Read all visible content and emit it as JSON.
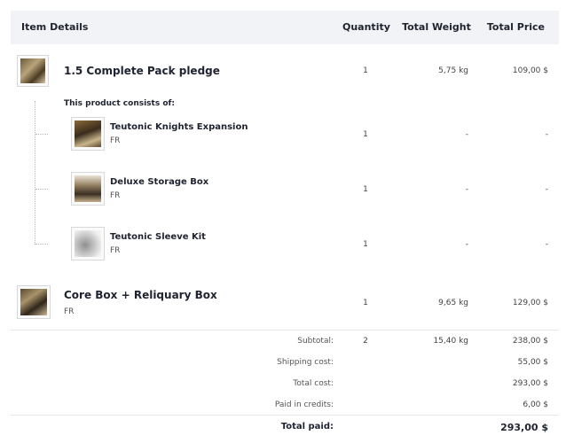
{
  "header": {
    "item_details": "Item Details",
    "quantity": "Quantity",
    "total_weight": "Total Weight",
    "total_price": "Total Price"
  },
  "items": [
    {
      "name": "1.5 Complete Pack pledge",
      "quantity": "1",
      "weight": "5,75 kg",
      "price": "109,00 $",
      "consists_label": "This product consists of:",
      "components": [
        {
          "name": "Teutonic Knights Expansion",
          "lang": "FR",
          "quantity": "1",
          "weight": "-",
          "price": "-"
        },
        {
          "name": "Deluxe Storage Box",
          "lang": "FR",
          "quantity": "1",
          "weight": "-",
          "price": "-"
        },
        {
          "name": "Teutonic Sleeve Kit",
          "lang": "FR",
          "quantity": "1",
          "weight": "-",
          "price": "-"
        }
      ]
    },
    {
      "name": "Core Box + Reliquary Box",
      "lang": "FR",
      "quantity": "1",
      "weight": "9,65 kg",
      "price": "129,00 $"
    }
  ],
  "summary": {
    "subtotal_label": "Subtotal:",
    "subtotal_qty": "2",
    "subtotal_weight": "15,40 kg",
    "subtotal_price": "238,00 $",
    "shipping_label": "Shipping cost:",
    "shipping_value": "55,00 $",
    "total_cost_label": "Total cost:",
    "total_cost_value": "293,00 $",
    "credits_label": "Paid in credits:",
    "credits_value": "6,00 $",
    "total_paid_label": "Total paid:",
    "total_paid_value": "293,00 $"
  }
}
